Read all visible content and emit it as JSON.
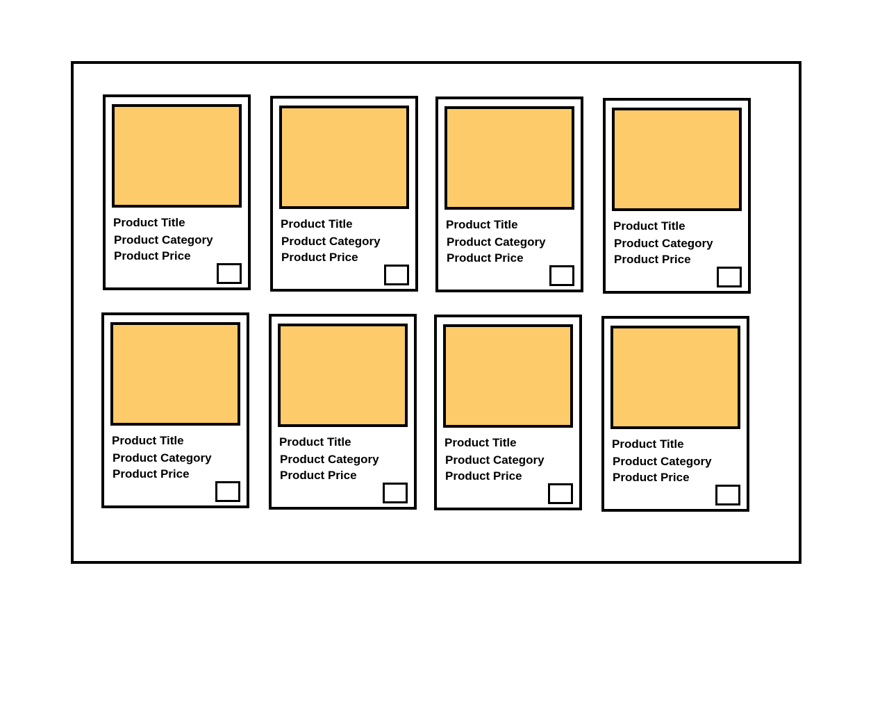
{
  "colors": {
    "image_fill": "#FDCB6A",
    "border": "#000000",
    "background": "#FFFFFF"
  },
  "products": [
    {
      "title": "Product Title",
      "category": "Product Category",
      "price": "Product Price"
    },
    {
      "title": "Product Title",
      "category": "Product Category",
      "price": "Product Price"
    },
    {
      "title": "Product Title",
      "category": "Product Category",
      "price": "Product Price"
    },
    {
      "title": "Product Title",
      "category": "Product Category",
      "price": "Product Price"
    },
    {
      "title": "Product Title",
      "category": "Product Category",
      "price": "Product Price"
    },
    {
      "title": "Product Title",
      "category": "Product Category",
      "price": "Product Price"
    },
    {
      "title": "Product Title",
      "category": "Product Category",
      "price": "Product Price"
    },
    {
      "title": "Product Title",
      "category": "Product Category",
      "price": "Product Price"
    }
  ]
}
